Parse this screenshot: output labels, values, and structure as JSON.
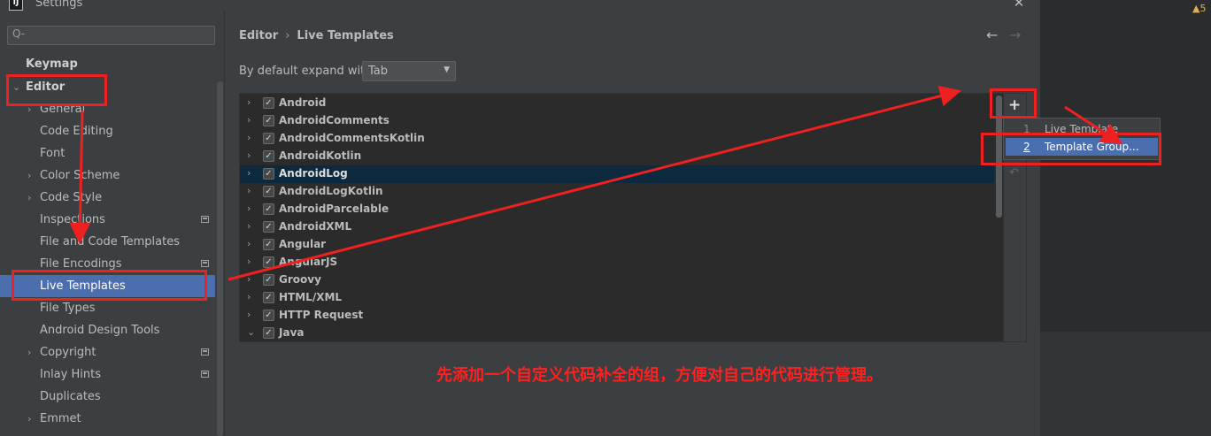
{
  "window": {
    "title": "Settings",
    "app_icon_letter": "IJ",
    "close_glyph": "✕"
  },
  "sidebar": {
    "search_placeholder": "Q-",
    "items": [
      {
        "label": "Keymap"
      },
      {
        "label": "Editor"
      },
      {
        "label": "General"
      },
      {
        "label": "Code Editing"
      },
      {
        "label": "Font"
      },
      {
        "label": "Color Scheme"
      },
      {
        "label": "Code Style"
      },
      {
        "label": "Inspections"
      },
      {
        "label": "File and Code Templates"
      },
      {
        "label": "File Encodings"
      },
      {
        "label": "Live Templates"
      },
      {
        "label": "File Types"
      },
      {
        "label": "Android Design Tools"
      },
      {
        "label": "Copyright"
      },
      {
        "label": "Inlay Hints"
      },
      {
        "label": "Duplicates"
      },
      {
        "label": "Emmet"
      }
    ]
  },
  "main": {
    "breadcrumb": {
      "root": "Editor",
      "separator": "›",
      "current": "Live Templates"
    },
    "expand_label": "By default expand with",
    "expand_value": "Tab",
    "templates": [
      {
        "label": "Android"
      },
      {
        "label": "AndroidComments"
      },
      {
        "label": "AndroidCommentsKotlin"
      },
      {
        "label": "AndroidKotlin"
      },
      {
        "label": "AndroidLog"
      },
      {
        "label": "AndroidLogKotlin"
      },
      {
        "label": "AndroidParcelable"
      },
      {
        "label": "AndroidXML"
      },
      {
        "label": "Angular"
      },
      {
        "label": "AngularJS"
      },
      {
        "label": "Groovy"
      },
      {
        "label": "HTML/XML"
      },
      {
        "label": "HTTP Request"
      },
      {
        "label": "Java"
      }
    ],
    "add_glyph": "+",
    "undo_glyph": "↶"
  },
  "popup": {
    "items": [
      {
        "num": "1",
        "label": "Live Template"
      },
      {
        "num": "2",
        "label": "Template Group..."
      }
    ]
  },
  "annotation": {
    "text": "先添加一个自定义代码补全的组，方便对自己的代码进行管理。",
    "color": "#ff2020"
  },
  "status": {
    "warning_count": "5"
  },
  "colors": {
    "selection": "#4b6eaf",
    "highlight_row": "#0d293e",
    "background": "#3c3f41"
  }
}
